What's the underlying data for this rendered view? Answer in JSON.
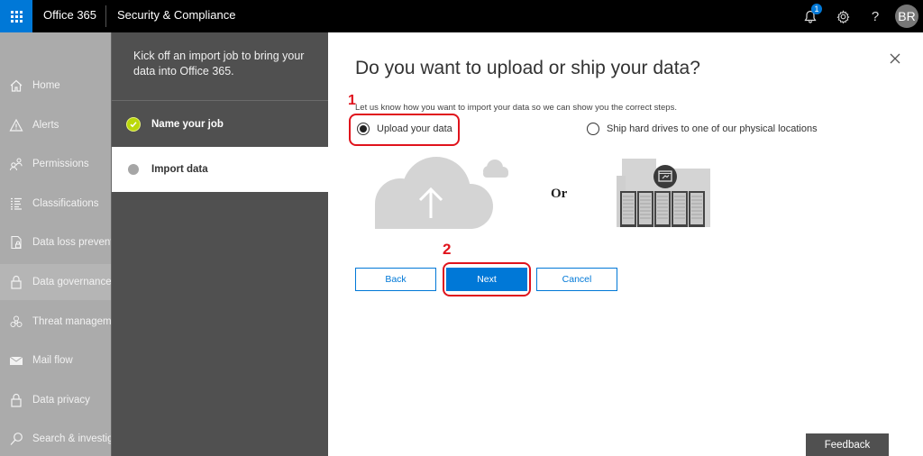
{
  "topbar": {
    "brand": "Office 365",
    "app_title": "Security & Compliance",
    "notification_count": "1",
    "help_label": "?",
    "user_initials": "BR",
    "accent_color": "#0078d7"
  },
  "sidebar": {
    "items": [
      {
        "label": "Home",
        "icon": "home-icon"
      },
      {
        "label": "Alerts",
        "icon": "alert-icon"
      },
      {
        "label": "Permissions",
        "icon": "permissions-icon"
      },
      {
        "label": "Classifications",
        "icon": "list-icon"
      },
      {
        "label": "Data loss prevention",
        "icon": "dlp-icon"
      },
      {
        "label": "Data governance",
        "icon": "lock-icon",
        "active": true
      },
      {
        "label": "Threat management",
        "icon": "biohazard-icon"
      },
      {
        "label": "Mail flow",
        "icon": "mail-icon"
      },
      {
        "label": "Data privacy",
        "icon": "lock-icon"
      },
      {
        "label": "Search & investigation",
        "icon": "search-icon"
      }
    ]
  },
  "wizard": {
    "intro": "Kick off an import job to bring your data into Office 365.",
    "steps": [
      {
        "label": "Name your job",
        "status": "complete"
      },
      {
        "label": "Import data",
        "status": "current"
      }
    ]
  },
  "panel": {
    "title": "Do you want to upload or ship your data?",
    "description": "Let us know how you want to import your data so we can show you the correct steps.",
    "options": [
      {
        "label": "Upload your data",
        "selected": true
      },
      {
        "label": "Ship hard drives to one of our physical locations",
        "selected": false
      }
    ],
    "or_label": "Or",
    "buttons": {
      "back": "Back",
      "next": "Next",
      "cancel": "Cancel"
    }
  },
  "annotations": {
    "step1": "1",
    "step2": "2",
    "color": "#e0131c"
  },
  "feedback_label": "Feedback"
}
